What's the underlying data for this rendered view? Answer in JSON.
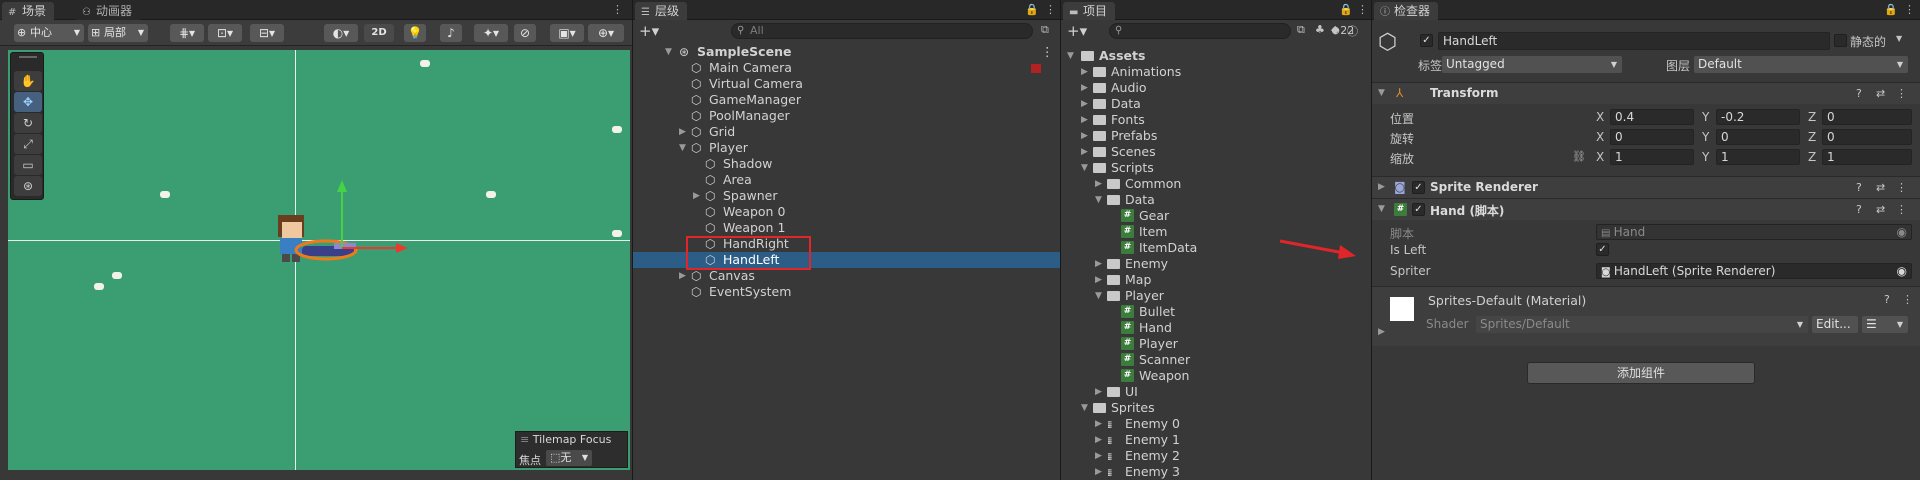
{
  "scene": {
    "tabs": [
      {
        "label": "场景"
      },
      {
        "label": "动画器"
      }
    ],
    "pivot_label": "中心",
    "space_label": "局部",
    "mode_2d": "2D",
    "tilemap_focus": {
      "title": "Tilemap Focus",
      "label": "焦点",
      "value": "无"
    }
  },
  "hierarchy": {
    "tab_label": "层级",
    "search_placeholder": "All",
    "items": [
      {
        "label": "SampleScene"
      },
      {
        "label": "Main Camera"
      },
      {
        "label": "Virtual Camera"
      },
      {
        "label": "GameManager"
      },
      {
        "label": "PoolManager"
      },
      {
        "label": "Grid"
      },
      {
        "label": "Player"
      },
      {
        "label": "Shadow"
      },
      {
        "label": "Area"
      },
      {
        "label": "Spawner"
      },
      {
        "label": "Weapon 0"
      },
      {
        "label": "Weapon 1"
      },
      {
        "label": "HandRight"
      },
      {
        "label": "HandLeft"
      },
      {
        "label": "Canvas"
      },
      {
        "label": "EventSystem"
      }
    ]
  },
  "project": {
    "tab_label": "项目",
    "hidden_count": "22",
    "items": [
      {
        "label": "Assets"
      },
      {
        "label": "Animations"
      },
      {
        "label": "Audio"
      },
      {
        "label": "Data"
      },
      {
        "label": "Fonts"
      },
      {
        "label": "Prefabs"
      },
      {
        "label": "Scenes"
      },
      {
        "label": "Scripts"
      },
      {
        "label": "Common"
      },
      {
        "label": "Data"
      },
      {
        "label": "Gear"
      },
      {
        "label": "Item"
      },
      {
        "label": "ItemData"
      },
      {
        "label": "Enemy"
      },
      {
        "label": "Map"
      },
      {
        "label": "Player"
      },
      {
        "label": "Bullet"
      },
      {
        "label": "Hand"
      },
      {
        "label": "Player"
      },
      {
        "label": "Scanner"
      },
      {
        "label": "Weapon"
      },
      {
        "label": "UI"
      },
      {
        "label": "Sprites"
      },
      {
        "label": "Enemy 0"
      },
      {
        "label": "Enemy 1"
      },
      {
        "label": "Enemy 2"
      },
      {
        "label": "Enemy 3"
      }
    ]
  },
  "inspector": {
    "tab_label": "检查器",
    "object_name": "HandLeft",
    "static_label": "静态的",
    "tag_label": "标签",
    "tag_value": "Untagged",
    "layer_label": "图层",
    "layer_value": "Default",
    "transform": {
      "title": "Transform",
      "position_label": "位置",
      "rotation_label": "旋转",
      "scale_label": "缩放",
      "axis_x": "X",
      "axis_y": "Y",
      "axis_z": "Z",
      "position": {
        "x": "0.4",
        "y": "-0.2",
        "z": "0"
      },
      "rotation": {
        "x": "0",
        "y": "0",
        "z": "0"
      },
      "scale": {
        "x": "1",
        "y": "1",
        "z": "1"
      }
    },
    "sprite_renderer": {
      "title": "Sprite Renderer"
    },
    "hand_script": {
      "title": "Hand (脚本)",
      "script_label": "脚本",
      "script_value": "Hand",
      "is_left_label": "Is Left",
      "spriter_label": "Spriter",
      "spriter_value": "HandLeft (Sprite Renderer)"
    },
    "material": {
      "title": "Sprites-Default (Material)",
      "shader_label": "Shader",
      "shader_value": "Sprites/Default",
      "edit_label": "Edit..."
    },
    "add_component": "添加组件"
  },
  "colors": {
    "scene_bg": "#3a9e72",
    "selection": "#2c5d87",
    "annotation_red": "#e0262a",
    "script_icon": "#3d7d3c"
  }
}
